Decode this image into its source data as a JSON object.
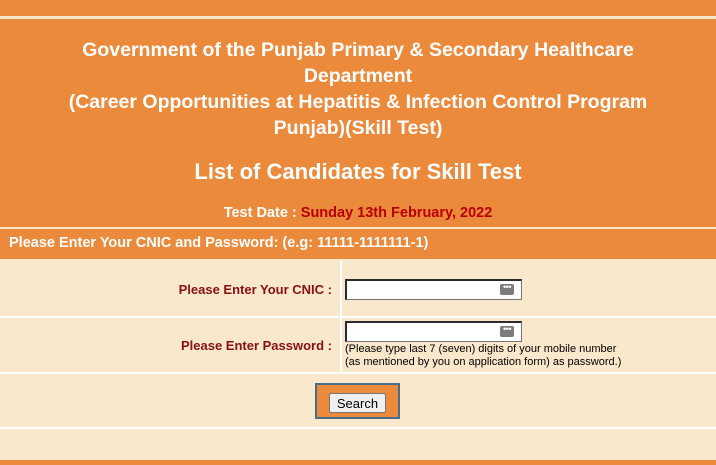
{
  "header": {
    "title_line1": "Government of the Punjab Primary & Secondary Healthcare",
    "title_line2": "Department",
    "title_line3": "(Career Opportunities at Hepatitis & Infection Control Program",
    "title_line4": "Punjab)(Skill Test)",
    "subtitle": "List of Candidates for Skill Test",
    "test_date_label": "Test Date :",
    "test_date_value": "Sunday 13th February, 2022"
  },
  "form": {
    "instruction": "Please Enter Your CNIC and Password: (e.g: 11111-1111111-1)",
    "cnic_label": "Please Enter Your CNIC :",
    "cnic_value": "",
    "password_label": "Please Enter Password :",
    "password_value": "",
    "password_hint_line1": "(Please type last 7 (seven) digits of your mobile number",
    "password_hint_line2": "(as mentioned by you on application form) as password.)",
    "search_label": "Search"
  },
  "colors": {
    "header_bg": "#ec8a3c",
    "form_bg": "#f9e8cc",
    "label_text": "#8a1010",
    "date_text": "#b80000",
    "button_frame_border": "#4a6b8a"
  },
  "icons": {
    "cnic_autofill": "key-dots-icon",
    "password_autofill": "key-dots-icon"
  }
}
